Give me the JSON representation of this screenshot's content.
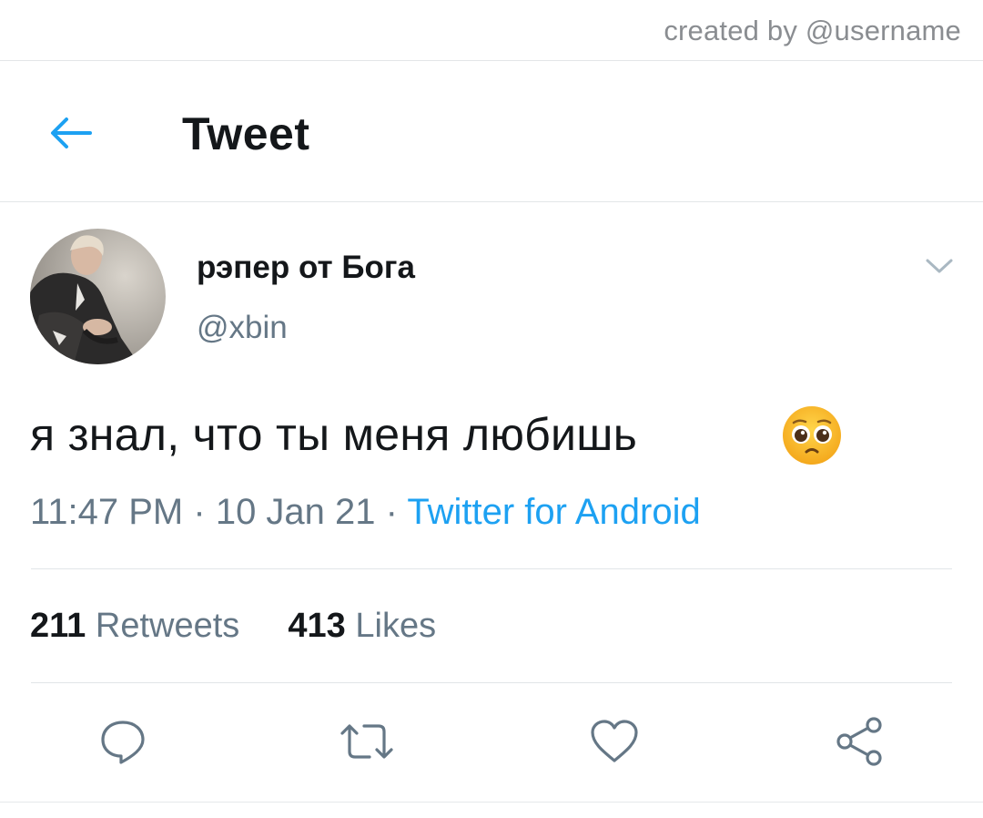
{
  "credit": "created by @username",
  "header": {
    "title": "Tweet",
    "back_icon": "arrow-left-icon"
  },
  "author": {
    "display_name": "рэпер от Бога",
    "handle": "@xbin",
    "menu_icon": "chevron-down-icon"
  },
  "tweet": {
    "text": "я знал, что ты меня любишь",
    "emoji_icon": "pleading-face-emoji",
    "time": "11:47 PM",
    "separator": "·",
    "date": "10 Jan 21",
    "source": "Twitter for Android"
  },
  "stats": {
    "retweets_count": "211",
    "retweets_label": "Retweets",
    "likes_count": "413",
    "likes_label": "Likes"
  },
  "actions": [
    {
      "name": "reply",
      "icon": "reply-icon"
    },
    {
      "name": "retweet",
      "icon": "retweet-icon"
    },
    {
      "name": "like",
      "icon": "heart-icon"
    },
    {
      "name": "share",
      "icon": "share-icon"
    }
  ],
  "colors": {
    "accent": "#1da1f2",
    "text": "#14171a",
    "secondary": "#657786",
    "icon": "#657786"
  }
}
